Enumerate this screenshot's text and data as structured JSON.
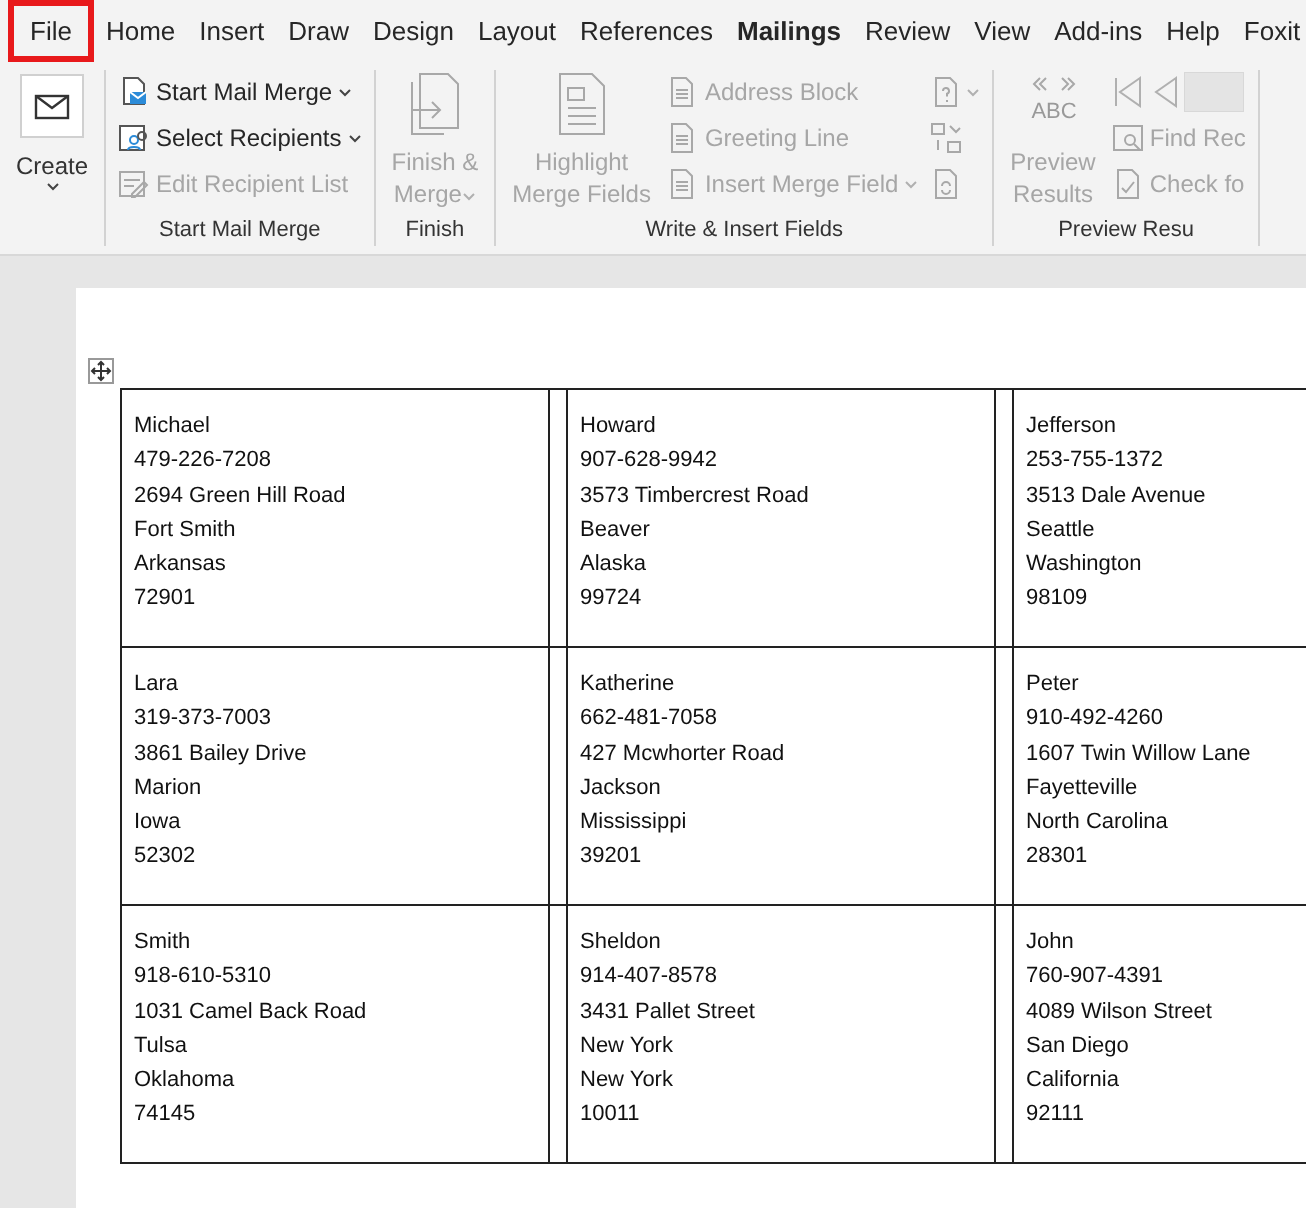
{
  "tabs": [
    {
      "label": "File",
      "selected": false,
      "highlighted": true
    },
    {
      "label": "Home",
      "selected": false,
      "highlighted": false
    },
    {
      "label": "Insert",
      "selected": false,
      "highlighted": false
    },
    {
      "label": "Draw",
      "selected": false,
      "highlighted": false
    },
    {
      "label": "Design",
      "selected": false,
      "highlighted": false
    },
    {
      "label": "Layout",
      "selected": false,
      "highlighted": false
    },
    {
      "label": "References",
      "selected": false,
      "highlighted": false
    },
    {
      "label": "Mailings",
      "selected": true,
      "highlighted": false
    },
    {
      "label": "Review",
      "selected": false,
      "highlighted": false
    },
    {
      "label": "View",
      "selected": false,
      "highlighted": false
    },
    {
      "label": "Add-ins",
      "selected": false,
      "highlighted": false
    },
    {
      "label": "Help",
      "selected": false,
      "highlighted": false
    },
    {
      "label": "Foxit",
      "selected": false,
      "highlighted": false
    }
  ],
  "ribbon": {
    "groups": [
      {
        "items": [
          {
            "kind": "large",
            "lines": [
              "Create"
            ],
            "dropdown": true,
            "disabled": false
          }
        ]
      },
      {
        "label": "Start Mail Merge",
        "items": [
          {
            "kind": "small",
            "label": "Start Mail Merge",
            "dropdown": true,
            "disabled": false
          },
          {
            "kind": "small",
            "label": "Select Recipients",
            "dropdown": true,
            "disabled": false
          },
          {
            "kind": "small",
            "label": "Edit Recipient List",
            "dropdown": false,
            "disabled": true
          }
        ]
      },
      {
        "label": "Finish",
        "items": [
          {
            "kind": "large",
            "lines": [
              "Finish &",
              "Merge"
            ],
            "dropdown": true,
            "disabled": true
          }
        ]
      },
      {
        "label": "Write & Insert Fields",
        "items": [
          {
            "kind": "large",
            "lines": [
              "Highlight",
              "Merge Fields"
            ],
            "dropdown": false,
            "disabled": true
          },
          {
            "kind": "small",
            "label": "Address Block",
            "dropdown": false,
            "disabled": true
          },
          {
            "kind": "small",
            "label": "Greeting Line",
            "dropdown": false,
            "disabled": true
          },
          {
            "kind": "small",
            "label": "Insert Merge Field",
            "dropdown": true,
            "disabled": true
          },
          {
            "kind": "icon",
            "dropdown": true,
            "disabled": true
          },
          {
            "kind": "icon",
            "dropdown": false,
            "disabled": true
          },
          {
            "kind": "icon",
            "dropdown": false,
            "disabled": true
          }
        ]
      },
      {
        "label": "Preview Resu",
        "items": [
          {
            "kind": "large",
            "icon_text": "ABC",
            "lines": [
              "Preview",
              "Results"
            ],
            "dropdown": false,
            "disabled": true
          },
          {
            "kind": "nav",
            "disabled": true
          },
          {
            "kind": "small",
            "label": "Find Rec",
            "dropdown": false,
            "disabled": true
          },
          {
            "kind": "small",
            "label": "Check fo",
            "dropdown": false,
            "disabled": true
          }
        ]
      }
    ]
  },
  "labels": [
    [
      [
        "Michael",
        "479-226-7208",
        "2694 Green Hill Road",
        "Fort Smith",
        "Arkansas",
        "72901"
      ],
      [
        "Howard",
        "907-628-9942",
        "3573 Timbercrest Road",
        "Beaver",
        "Alaska",
        "99724"
      ],
      [
        "Jefferson",
        "253-755-1372",
        "3513 Dale Avenue",
        "Seattle",
        "Washington",
        "98109"
      ]
    ],
    [
      [
        "Lara",
        "319-373-7003",
        "3861 Bailey Drive",
        "Marion",
        "Iowa",
        "52302"
      ],
      [
        "Katherine",
        "662-481-7058",
        "427 Mcwhorter Road",
        "Jackson",
        "Mississippi",
        "39201"
      ],
      [
        "Peter",
        "910-492-4260",
        "1607 Twin Willow Lane",
        "Fayetteville",
        "North Carolina",
        "28301"
      ]
    ],
    [
      [
        "Smith",
        "918-610-5310",
        "1031 Camel Back Road",
        "Tulsa",
        "Oklahoma",
        "74145"
      ],
      [
        "Sheldon",
        "914-407-8578",
        "3431 Pallet Street",
        "New York",
        "New York",
        "10011"
      ],
      [
        "John",
        "760-907-4391",
        "4089 Wilson Street",
        "San Diego",
        "California",
        "92111"
      ]
    ]
  ]
}
